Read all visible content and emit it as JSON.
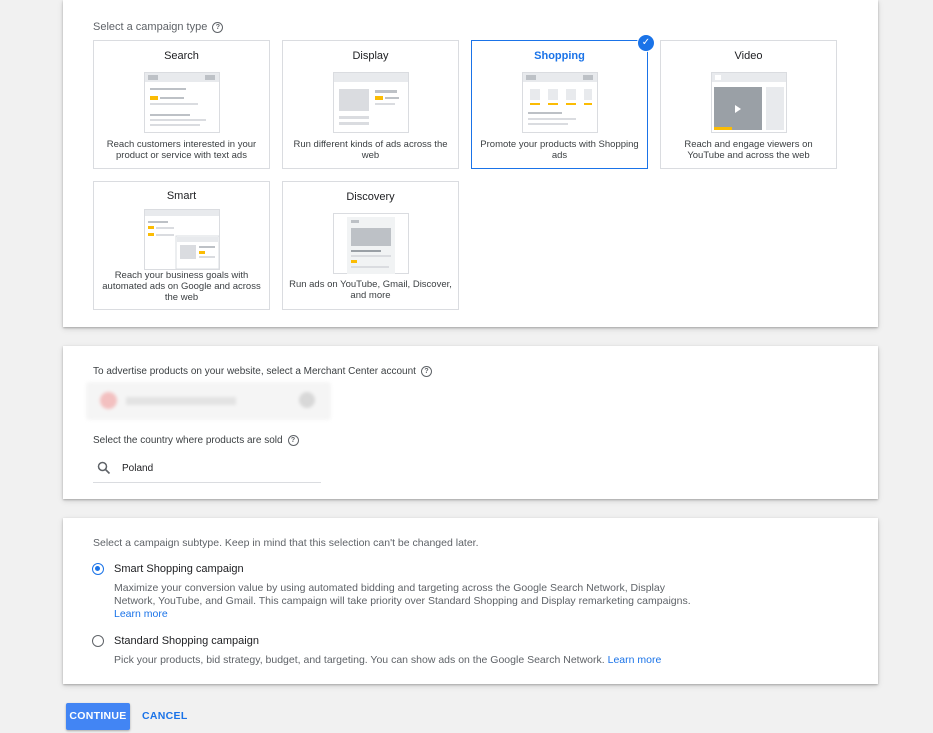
{
  "campaign_type": {
    "label": "Select a campaign type",
    "help_icon": "help-circle-icon",
    "cards": [
      {
        "title": "Search",
        "desc": "Reach customers interested in your product or service with text ads",
        "selected": false
      },
      {
        "title": "Display",
        "desc": "Run different kinds of ads across the web",
        "selected": false
      },
      {
        "title": "Shopping",
        "desc": "Promote your products with Shopping ads",
        "selected": true
      },
      {
        "title": "Video",
        "desc": "Reach and engage viewers on YouTube and across the web",
        "selected": false
      },
      {
        "title": "Smart",
        "desc": "Reach your business goals with automated ads on Google and across the web",
        "selected": false
      },
      {
        "title": "Discovery",
        "desc": "Run ads on YouTube, Gmail, Discover, and more",
        "selected": false
      }
    ],
    "selected_check_icon": "check-circle-icon"
  },
  "merchant": {
    "account_label": "To advertise products on your website, select a Merchant Center account",
    "country_label": "Select the country where products are sold",
    "country_value": "Poland",
    "search_icon": "search-icon"
  },
  "subtype": {
    "label": "Select a campaign subtype. Keep in mind that this selection can't be changed later.",
    "options": [
      {
        "title": "Smart Shopping campaign",
        "desc": "Maximize your conversion value by using automated bidding and targeting across the Google Search Network, Display Network, YouTube, and Gmail. This campaign will take priority over Standard Shopping and Display remarketing campaigns.",
        "link": "Learn more",
        "selected": true
      },
      {
        "title": "Standard Shopping campaign",
        "desc": "Pick your products, bid strategy, budget, and targeting. You can show ads on the Google Search Network.",
        "link": "Learn more",
        "selected": false
      }
    ]
  },
  "actions": {
    "continue_label": "CONTINUE",
    "cancel_label": "CANCEL"
  },
  "colors": {
    "accent": "#1a73e8",
    "button": "#4285f4",
    "highlight": "#fbbc04"
  }
}
